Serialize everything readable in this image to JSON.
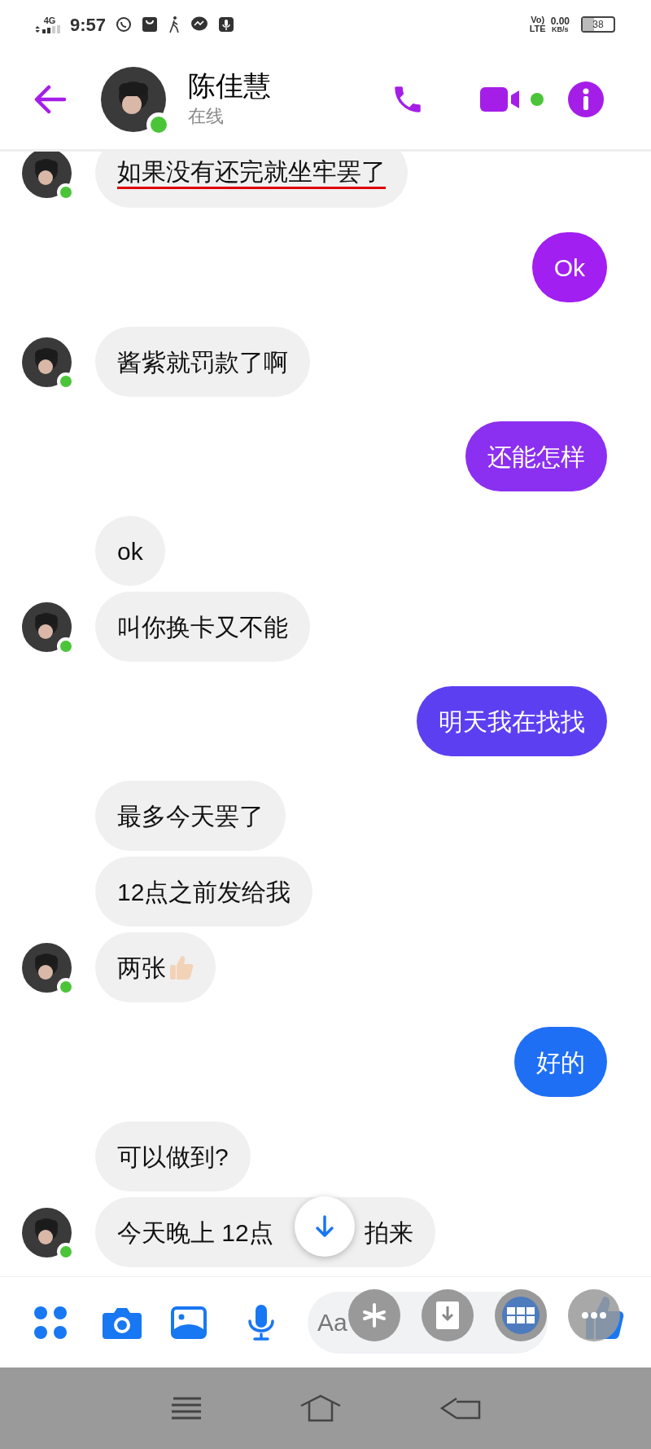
{
  "status_bar": {
    "network": "4G",
    "time": "9:57",
    "volte": "Vo)",
    "lte": "LTE",
    "speed": "0.00",
    "speed_unit": "KB/s",
    "battery": "38"
  },
  "header": {
    "name": "陈佳慧",
    "status": "在线",
    "online": true
  },
  "messages": [
    {
      "kind": "incoming",
      "bubbles": [
        {
          "kind": "text",
          "segments": [
            "如果没有还完就坐牢罢了"
          ],
          "underlined": true
        }
      ]
    },
    {
      "kind": "outgoing",
      "bubbles": [
        {
          "kind": "text",
          "segments": [
            "Ok"
          ],
          "color": "#a11ff0",
          "underlined": false
        }
      ]
    },
    {
      "kind": "incoming",
      "bubbles": [
        {
          "kind": "text",
          "segments": [
            "酱紫就罚款了啊"
          ],
          "underlined": false
        }
      ]
    },
    {
      "kind": "outgoing",
      "bubbles": [
        {
          "kind": "text",
          "segments": [
            "还能怎样"
          ],
          "color": "#8b2ff0",
          "underlined": false
        }
      ]
    },
    {
      "kind": "incoming",
      "bubbles": [
        {
          "kind": "text",
          "segments": [
            "ok"
          ],
          "underlined": false
        },
        {
          "kind": "text",
          "segments": [
            "叫你换卡又不能"
          ],
          "underlined": false
        }
      ]
    },
    {
      "kind": "outgoing",
      "bubbles": [
        {
          "kind": "text",
          "segments": [
            "明天我在找找"
          ],
          "color": "#5d3ff2",
          "underlined": false
        }
      ]
    },
    {
      "kind": "incoming",
      "bubbles": [
        {
          "kind": "text",
          "segments": [
            "最多今天罢了"
          ],
          "underlined": false
        },
        {
          "kind": "text",
          "segments": [
            "12点之前发给我"
          ],
          "underlined": false
        },
        {
          "kind": "thumb",
          "segments": [
            "两张"
          ],
          "underlined": false
        }
      ]
    },
    {
      "kind": "outgoing",
      "bubbles": [
        {
          "kind": "text",
          "segments": [
            "好的"
          ],
          "color": "#1f6ff5",
          "underlined": false
        }
      ]
    },
    {
      "kind": "incoming",
      "bubbles": [
        {
          "kind": "text",
          "segments": [
            "可以做到?"
          ],
          "underlined": false
        },
        {
          "kind": "text",
          "segments": [
            "今天晚上 12点",
            "拍来"
          ],
          "underlined": false
        }
      ]
    }
  ],
  "composer": {
    "placeholder": "Aa"
  }
}
